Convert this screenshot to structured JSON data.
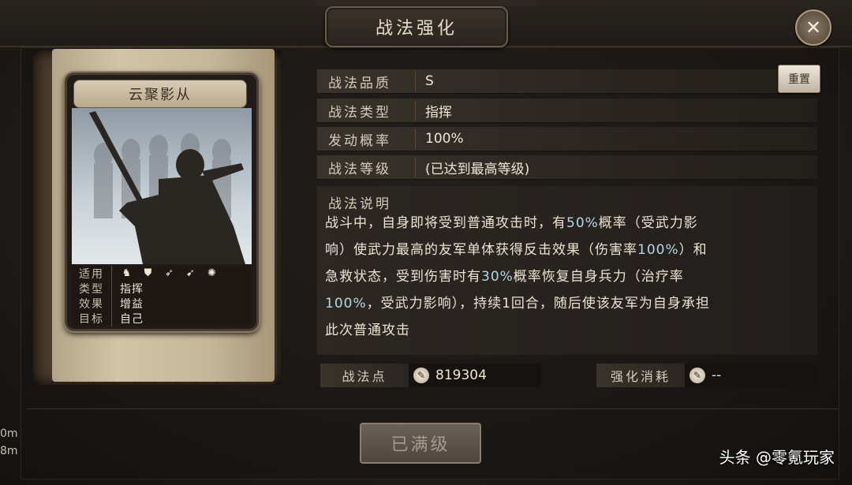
{
  "window": {
    "title": "战法强化",
    "close_icon": "close-icon"
  },
  "card": {
    "name": "云聚影从",
    "info": [
      {
        "label": "适用",
        "icons": [
          "cavalry-icon",
          "shield-icon",
          "bow-icon",
          "spear-icon",
          "wheel-icon"
        ]
      },
      {
        "label": "类型",
        "value": "指挥"
      },
      {
        "label": "效果",
        "value": "增益"
      },
      {
        "label": "目标",
        "value": "自己"
      }
    ]
  },
  "rows": [
    {
      "label": "战法品质",
      "value": "S"
    },
    {
      "label": "战法类型",
      "value": "指挥"
    },
    {
      "label": "发动概率",
      "value": "100%"
    },
    {
      "label": "战法等级",
      "value": "(已达到最高等级)"
    }
  ],
  "reset_label": "重置",
  "description": {
    "title": "战法说明",
    "lines": [
      [
        "战斗中，自身即将受到普通攻击时，有",
        "50%",
        "概率（受武力影"
      ],
      [
        "响）使武力最高的友军单体获得反击效果（伤害率",
        "100%",
        "）和"
      ],
      [
        "急救状态，受到伤害时有",
        "30%",
        "概率恢复自身兵力（治疗率"
      ],
      [
        "",
        "100%",
        "，受武力影响），持续1回合，随后使该友军为自身承担"
      ],
      [
        "此次普通攻击",
        "",
        ""
      ]
    ]
  },
  "points": {
    "label": "战法点",
    "value": "819304"
  },
  "cost": {
    "label": "强化消耗",
    "value": "--"
  },
  "max_button_label": "已满级",
  "side_left": [
    "0m",
    "8m"
  ],
  "watermark": "头条 @零氪玩家"
}
